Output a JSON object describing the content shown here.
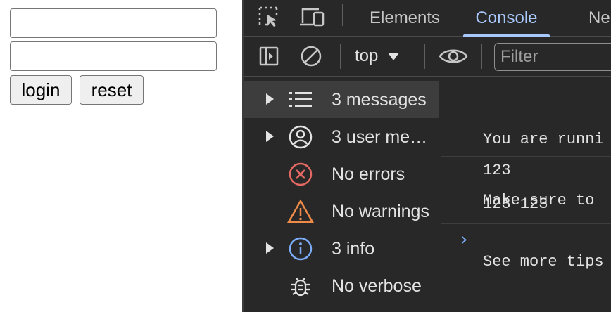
{
  "page": {
    "login_label": "login",
    "reset_label": "reset"
  },
  "devtools": {
    "tabs": [
      {
        "label": "Elements",
        "active": false
      },
      {
        "label": "Console",
        "active": true
      },
      {
        "label": "Ne",
        "active": false
      }
    ],
    "toolbar": {
      "context": "top",
      "filter_placeholder": "Filter"
    },
    "sidebar": [
      {
        "label": "3 messages",
        "icon": "list-icon",
        "expandable": true,
        "selected": true
      },
      {
        "label": "3 user me…",
        "icon": "user-circle-icon",
        "expandable": true,
        "selected": false
      },
      {
        "label": "No errors",
        "icon": "error-circle-icon",
        "expandable": false,
        "selected": false
      },
      {
        "label": "No warnings",
        "icon": "warning-triangle-icon",
        "expandable": false,
        "selected": false
      },
      {
        "label": "3 info",
        "icon": "info-circle-icon",
        "expandable": true,
        "selected": false
      },
      {
        "label": "No verbose",
        "icon": "bug-icon",
        "expandable": false,
        "selected": false
      }
    ],
    "console": {
      "intro_lines": [
        "You are runni",
        "Make sure to",
        "See more tips"
      ],
      "logs": [
        "123",
        "123 123"
      ],
      "prompt": "›"
    }
  },
  "colors": {
    "devtools_bg": "#282828",
    "accent": "#a8c7fa",
    "error": "#e46962",
    "warning": "#ee8b49",
    "info": "#7cacf8"
  }
}
